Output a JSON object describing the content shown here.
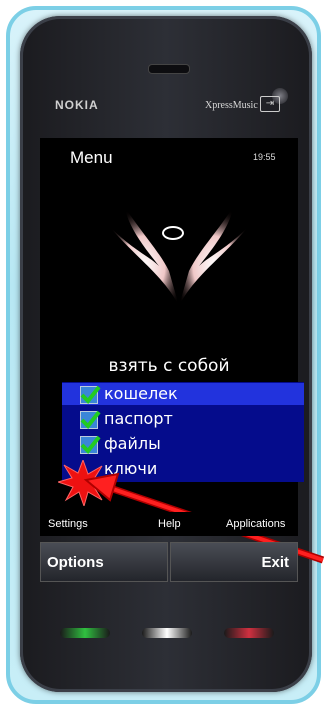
{
  "device": {
    "brand": "NOKIA",
    "model": "XpressMusic",
    "model_icon": "exit-arrow-icon"
  },
  "status_bar": {
    "title": "Menu",
    "time": "19:55"
  },
  "content": {
    "caption": "взять с собой",
    "items": [
      {
        "label": "кошелек",
        "checked": true,
        "selected": true
      },
      {
        "label": "паспорт",
        "checked": false,
        "selected": false
      },
      {
        "label": "файлы",
        "checked": true,
        "selected": false
      },
      {
        "label": "ключи",
        "checked": false,
        "selected": false
      }
    ]
  },
  "tabs": {
    "left": "Settings",
    "middle": "Help",
    "right": "Applications"
  },
  "softkeys": {
    "left": "Options",
    "right": "Exit"
  },
  "colors": {
    "list_bg": "#050c8c",
    "selected_bg": "#2233dd",
    "arrow": "#e01010",
    "call_green": "#30c040",
    "end_red": "#d03040"
  }
}
